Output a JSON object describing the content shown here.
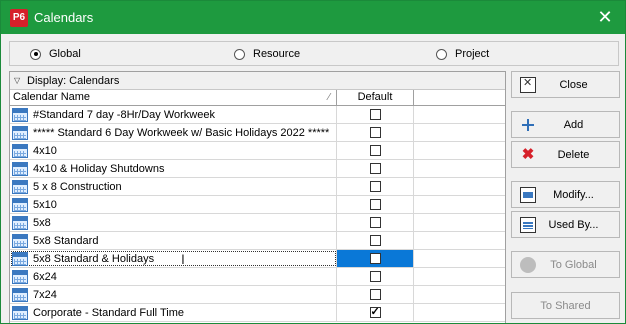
{
  "window": {
    "title": "Calendars",
    "app_badge": "P6",
    "close_glyph": "✕"
  },
  "scope": {
    "options": [
      {
        "label": "Global",
        "selected": true
      },
      {
        "label": "Resource",
        "selected": false
      },
      {
        "label": "Project",
        "selected": false
      }
    ]
  },
  "grid": {
    "display_label": "Display: Calendars",
    "columns": {
      "name": "Calendar Name",
      "default": "Default"
    },
    "rows": [
      {
        "name": "#Standard 7 day -8Hr/Day Workweek",
        "default": false
      },
      {
        "name": "***** Standard 6 Day Workweek w/ Basic Holidays 2022  *****",
        "default": false
      },
      {
        "name": "4x10",
        "default": false
      },
      {
        "name": "4x10 & Holiday Shutdowns",
        "default": false
      },
      {
        "name": "5 x 8 Construction",
        "default": false
      },
      {
        "name": "5x10",
        "default": false
      },
      {
        "name": "5x8",
        "default": false
      },
      {
        "name": "5x8 Standard",
        "default": false
      },
      {
        "name": "5x8 Standard & Holidays",
        "default": false,
        "selected": true
      },
      {
        "name": "6x24",
        "default": false
      },
      {
        "name": "7x24",
        "default": false
      },
      {
        "name": "Corporate - Standard Full Time",
        "default": true
      }
    ]
  },
  "buttons": {
    "close": "Close",
    "add": "Add",
    "delete": "Delete",
    "modify": "Modify...",
    "used_by": "Used By...",
    "to_global": "To Global",
    "to_shared": "To Shared"
  },
  "colors": {
    "titlebar": "#1e9a3f",
    "selection": "#0a78d7",
    "badge": "#d6202a"
  }
}
